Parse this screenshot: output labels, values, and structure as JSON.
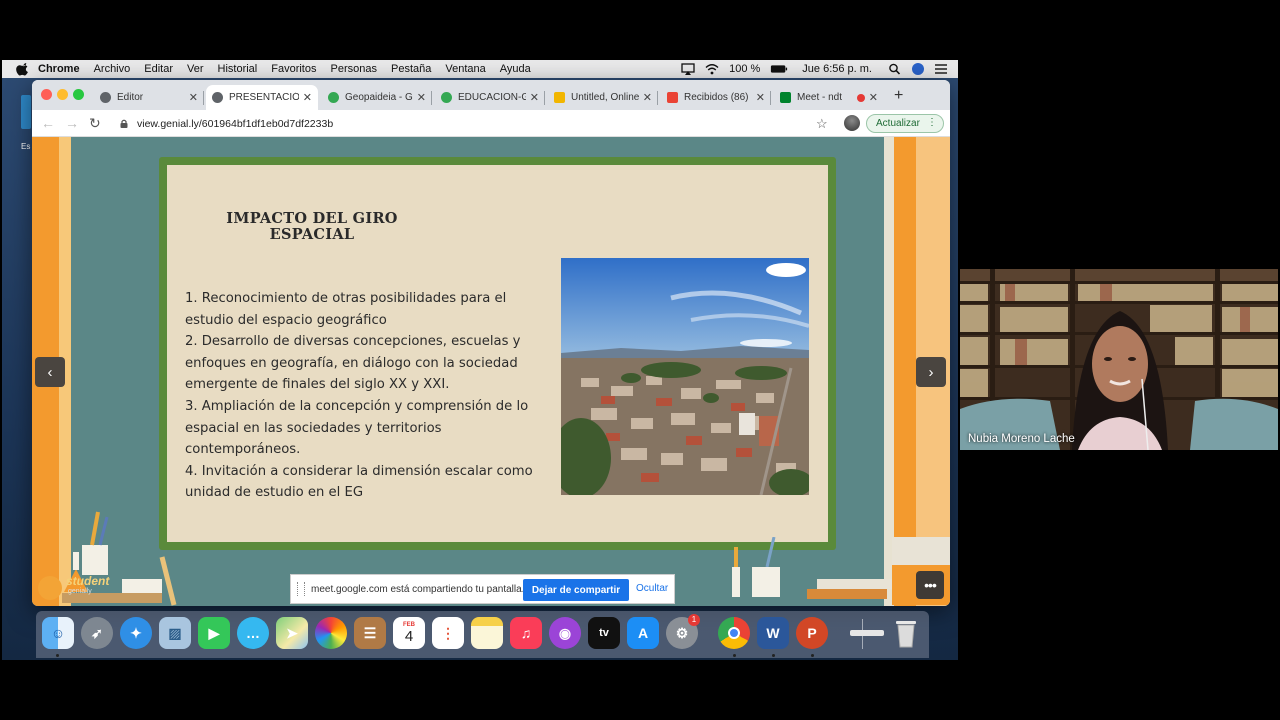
{
  "menubar": {
    "app": "Chrome",
    "items": [
      "Archivo",
      "Editar",
      "Ver",
      "Historial",
      "Favoritos",
      "Personas",
      "Pestaña",
      "Ventana",
      "Ayuda"
    ],
    "battery": "100 %",
    "clock": "Jue 6:56 p. m."
  },
  "browser": {
    "tabs": [
      {
        "label": "Editor",
        "favicon_color": "#5f6368"
      },
      {
        "label": "PRESENTACIÓN",
        "favicon_color": "#5f6368",
        "active": true
      },
      {
        "label": "Geopaideia - G",
        "favicon_color": "#34a853"
      },
      {
        "label": "EDUCACION-G",
        "favicon_color": "#34a853"
      },
      {
        "label": "Untitled, Online",
        "favicon_color": "#f2b600"
      },
      {
        "label": "Recibidos (86)",
        "favicon_color": "#ea4335"
      },
      {
        "label": "Meet - ndt",
        "favicon_color": "#00832d"
      }
    ],
    "url": "view.genial.ly/601964bf1df1eb0d7df2233b",
    "update_label": "Actualizar"
  },
  "slide": {
    "title": "IMPACTO DEL GIRO ESPACIAL",
    "items": [
      "1. Reconocimiento de otras posibilidades para el estudio del espacio geográfico",
      "2. Desarrollo de diversas concepciones, escuelas y enfoques en geografía, en diálogo con la sociedad emergente de finales del siglo XX y XXI.",
      "3. Ampliación de la concepción  y comprensión de lo espacial en las sociedades y territorios contemporáneos.",
      "4. Invitación a considerar la dimensión escalar como unidad de estudio en el EG"
    ]
  },
  "genially": {
    "logo_word": "student",
    "logo_sub": "genially"
  },
  "sharebar": {
    "message": "meet.google.com está compartiendo tu pantalla.",
    "stop_label": "Dejar de compartir",
    "hide_label": "Ocultar"
  },
  "dock": {
    "calendar_day": "4",
    "calendar_month": "FEB",
    "appletv_label": "tv",
    "word_letter": "W",
    "powerpoint_letter": "P",
    "settings_badge": "1"
  },
  "participant": {
    "name": "Nubia Moreno Lache"
  }
}
